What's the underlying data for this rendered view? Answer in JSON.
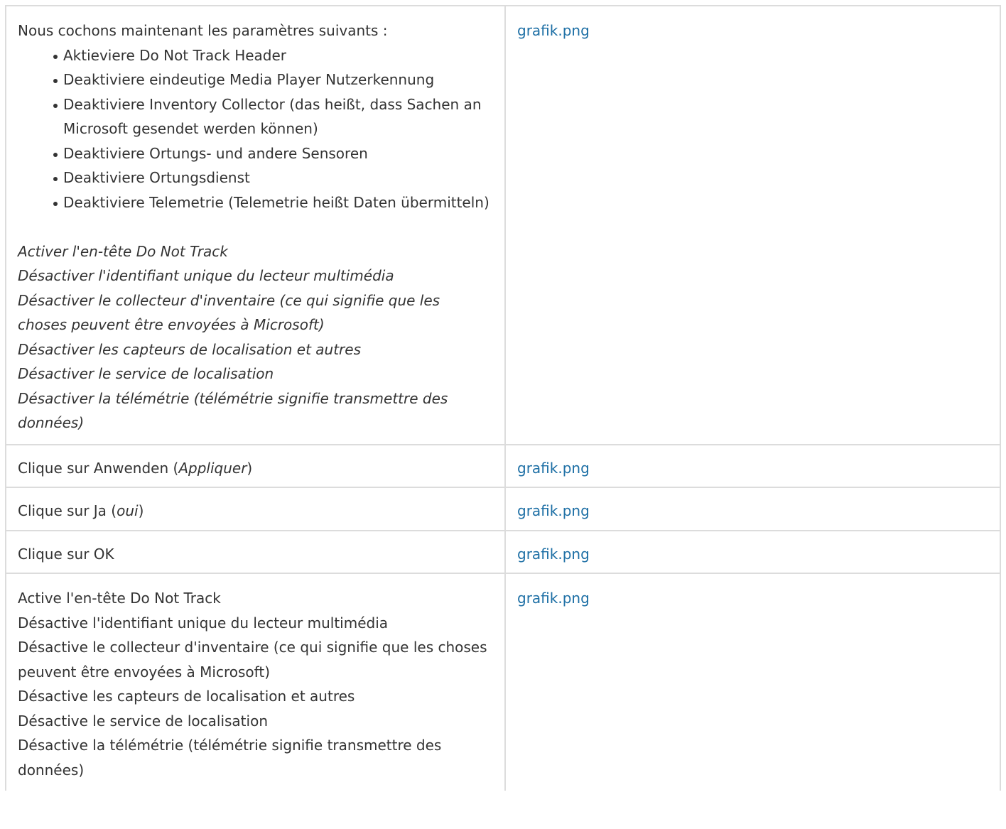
{
  "rows": [
    {
      "intro": "Nous cochons maintenant les paramètres suivants :",
      "bullets": [
        "Aktieviere Do Not Track Header",
        "Deaktiviere eindeutige Media Player Nutzerkennung",
        "Deaktiviere Inventory Collector (das heißt, dass Sachen an Microsoft gesendet werden können)",
        "Deaktiviere Ortungs- und andere Sensoren",
        "Deaktiviere Ortungsdienst",
        "Deaktiviere Telemetrie (Telemetrie heißt Daten übermitteln)"
      ],
      "translations": [
        "Activer l'en-tête Do Not Track",
        "Désactiver l'identifiant unique du lecteur multimédia",
        "Désactiver le collecteur d'inventaire (ce qui signifie que les choses peuvent être envoyées à Microsoft)",
        "Désactiver les capteurs de localisation et autres",
        "Désactiver le service de localisation",
        "Désactiver la télémétrie (télémétrie signifie transmettre des données)"
      ],
      "link": "grafik.png"
    },
    {
      "prefix": "Clique sur Anwenden (",
      "emph": "Appliquer",
      "suffix": ")",
      "link": "grafik.png"
    },
    {
      "prefix": "Clique sur Ja (",
      "emph": "oui",
      "suffix": ")",
      "link": "grafik.png"
    },
    {
      "text": "Clique sur OK",
      "link": "grafik.png"
    },
    {
      "lines": [
        "Active l'en-tête Do Not Track",
        "Désactive l'identifiant unique du lecteur multimédia",
        "Désactive le collecteur d'inventaire (ce qui signifie que les choses peuvent être envoyées à Microsoft)",
        "Désactive les capteurs de localisation et autres",
        "Désactive le service de localisation",
        "Désactive la télémétrie (télémétrie signifie transmettre des données)"
      ],
      "link": "grafik.png"
    }
  ],
  "colors": {
    "text": "#333333",
    "link": "#1d6fa5",
    "border": "#dcdcdc"
  }
}
